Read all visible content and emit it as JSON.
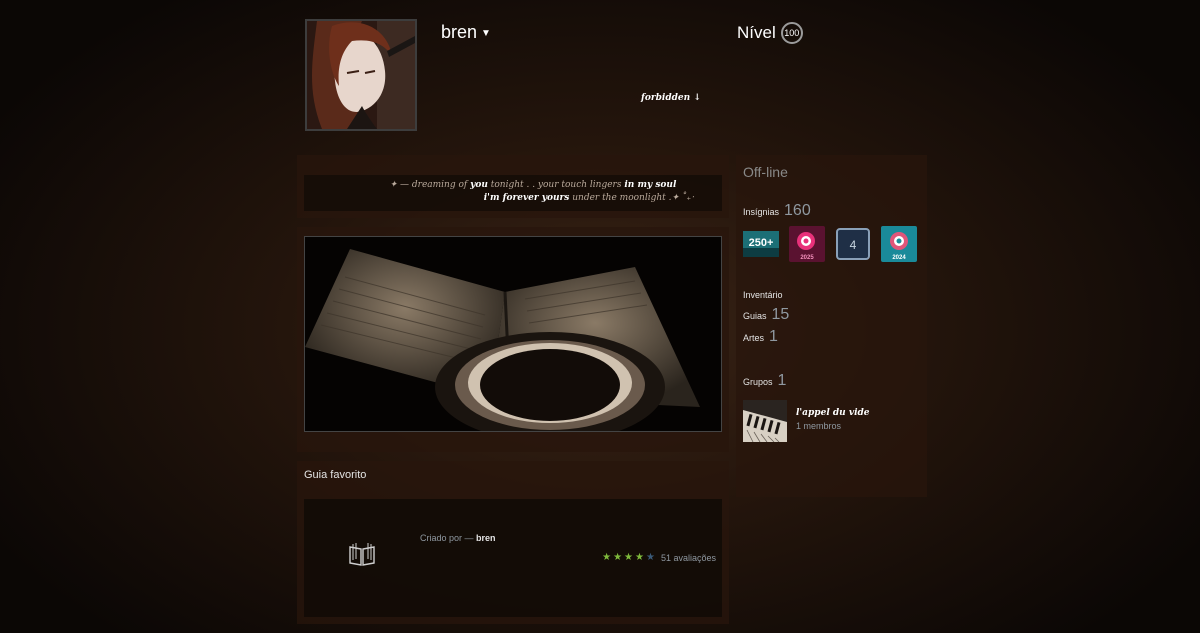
{
  "profile": {
    "persona_name": "bren",
    "level_label": "Nível",
    "level": "100",
    "tagline": "forbidden ↓"
  },
  "quote": {
    "line1_prefix": "✦ —  dreaming of ",
    "line1_bold1": "you",
    "line1_mid": " tonight . . your touch lingers ",
    "line1_bold2": "in my soul",
    "line2_bold": "i'm forever yours",
    "line2_suffix": " under the moonlight .✦ ˚₊‧"
  },
  "favorite_guide": {
    "title": "Guia favorito",
    "author_prefix": "Criado por — ",
    "author": "bren",
    "stars_on": 4,
    "stars_total": 5,
    "ratings_text": "51 avaliações",
    "icon": "book-icon"
  },
  "sidebar": {
    "status": "Off-line",
    "badges_label": "Insígnias",
    "badges_count": "160",
    "badges": [
      {
        "name": "badge-250-plus",
        "text": "250+"
      },
      {
        "name": "badge-2025",
        "text": "2025"
      },
      {
        "name": "badge-4",
        "text": "4"
      },
      {
        "name": "badge-2024",
        "text": "2024"
      }
    ],
    "inventory_label": "Inventário",
    "guides_label": "Guias",
    "guides_count": "15",
    "art_label": "Artes",
    "art_count": "1",
    "groups_label": "Grupos",
    "groups_count": "1",
    "group": {
      "name": "l'appel du vide",
      "members": "1 membros"
    }
  },
  "colors": {
    "star_on": "#7fba3c",
    "star_off": "#3a5a78",
    "muted_text": "#8f98a0"
  }
}
